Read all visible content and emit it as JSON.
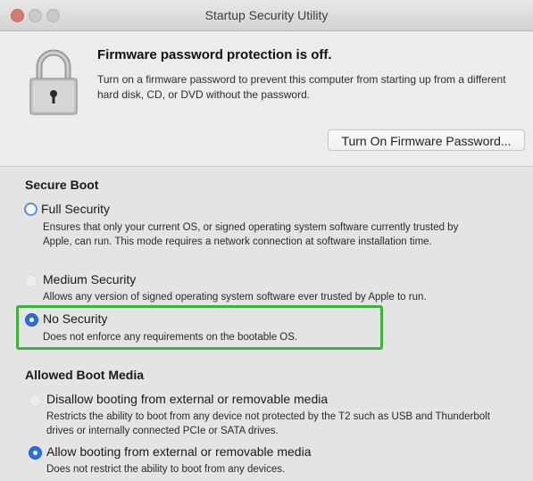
{
  "window": {
    "title": "Startup Security Utility"
  },
  "firmware": {
    "title": "Firmware password protection is off.",
    "description": "Turn on a firmware password to prevent this computer from starting up from a different hard disk, CD, or DVD without the password.",
    "button_label": "Turn On Firmware Password..."
  },
  "secure_boot": {
    "title": "Secure Boot",
    "options": [
      {
        "label": "Full Security",
        "description": "Ensures that only your current OS, or signed operating system software currently trusted by Apple, can run. This mode requires a network connection at software installation time.",
        "selected": false
      },
      {
        "label": "Medium Security",
        "description": "Allows any version of signed operating system software ever trusted by Apple to run.",
        "selected": false
      },
      {
        "label": "No Security",
        "description": "Does not enforce any requirements on the bootable OS.",
        "selected": true
      }
    ]
  },
  "boot_media": {
    "title": "Allowed Boot Media",
    "options": [
      {
        "label": "Disallow booting from external or removable media",
        "description": "Restricts the ability to boot from any device not protected by the T2 such as USB and Thunderbolt drives or internally connected PCIe or SATA drives.",
        "selected": false
      },
      {
        "label": "Allow booting from external or removable media",
        "description": "Does not restrict the ability to boot from any devices.",
        "selected": true
      }
    ]
  },
  "colors": {
    "highlight": "#3bb33a",
    "accent": "#2c6fd6"
  },
  "icons": {
    "lock": "lock-icon"
  }
}
